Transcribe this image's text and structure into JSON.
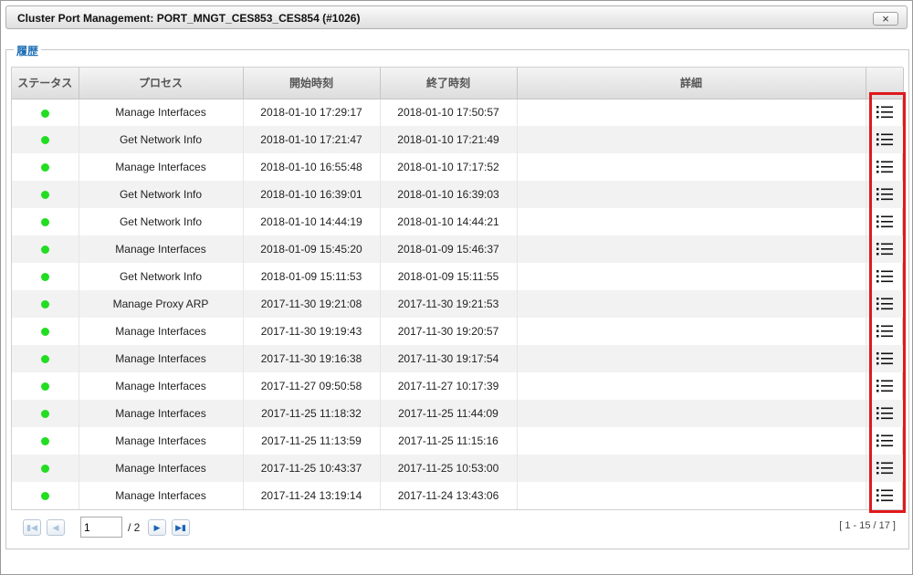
{
  "window": {
    "title": "Cluster Port Management: PORT_MNGT_CES853_CES854 (#1026)",
    "close_label": "×"
  },
  "history": {
    "legend": "履歴",
    "columns": [
      "ステータス",
      "プロセス",
      "開始時刻",
      "終了時刻",
      "詳細",
      ""
    ],
    "rows": [
      {
        "process": "Manage Interfaces",
        "start": "2018-01-10 17:29:17",
        "end": "2018-01-10 17:50:57"
      },
      {
        "process": "Get Network Info",
        "start": "2018-01-10 17:21:47",
        "end": "2018-01-10 17:21:49"
      },
      {
        "process": "Manage Interfaces",
        "start": "2018-01-10 16:55:48",
        "end": "2018-01-10 17:17:52"
      },
      {
        "process": "Get Network Info",
        "start": "2018-01-10 16:39:01",
        "end": "2018-01-10 16:39:03"
      },
      {
        "process": "Get Network Info",
        "start": "2018-01-10 14:44:19",
        "end": "2018-01-10 14:44:21"
      },
      {
        "process": "Manage Interfaces",
        "start": "2018-01-09 15:45:20",
        "end": "2018-01-09 15:46:37"
      },
      {
        "process": "Get Network Info",
        "start": "2018-01-09 15:11:53",
        "end": "2018-01-09 15:11:55"
      },
      {
        "process": "Manage Proxy ARP",
        "start": "2017-11-30 19:21:08",
        "end": "2017-11-30 19:21:53"
      },
      {
        "process": "Manage Interfaces",
        "start": "2017-11-30 19:19:43",
        "end": "2017-11-30 19:20:57"
      },
      {
        "process": "Manage Interfaces",
        "start": "2017-11-30 19:16:38",
        "end": "2017-11-30 19:17:54"
      },
      {
        "process": "Manage Interfaces",
        "start": "2017-11-27 09:50:58",
        "end": "2017-11-27 10:17:39"
      },
      {
        "process": "Manage Interfaces",
        "start": "2017-11-25 11:18:32",
        "end": "2017-11-25 11:44:09"
      },
      {
        "process": "Manage Interfaces",
        "start": "2017-11-25 11:13:59",
        "end": "2017-11-25 11:15:16"
      },
      {
        "process": "Manage Interfaces",
        "start": "2017-11-25 10:43:37",
        "end": "2017-11-25 10:53:00"
      },
      {
        "process": "Manage Interfaces",
        "start": "2017-11-24 13:19:14",
        "end": "2017-11-24 13:43:06"
      }
    ],
    "status_color": "#22dd22"
  },
  "pager": {
    "first_icon": "first-page-icon",
    "prev_icon": "prev-page-icon",
    "next_icon": "next-page-icon",
    "last_icon": "last-page-icon",
    "page_value": "1",
    "page_total": "/ 2",
    "range": "[ 1 - 15 / 17 ]"
  },
  "highlight_color": "#e0191b"
}
